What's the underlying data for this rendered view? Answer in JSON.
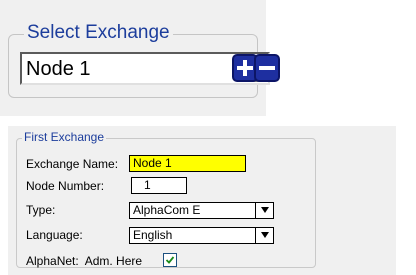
{
  "select_exchange": {
    "legend": "Select Exchange",
    "selected": "Node 1",
    "add_icon": "plus-icon",
    "remove_icon": "minus-icon"
  },
  "first_exchange": {
    "legend": "First Exchange",
    "exchange_name_label": "Exchange Name:",
    "exchange_name_value": "Node 1",
    "node_number_label": "Node Number:",
    "node_number_value": "1",
    "type_label": "Type:",
    "type_value": "AlphaCom E",
    "language_label": "Language:",
    "language_value": "English",
    "alphanet_label": "AlphaNet:  Adm. Here",
    "alphanet_checked": true
  },
  "colors": {
    "legend": "#1c3d9c",
    "highlight": "#ffff00",
    "button_blue": "#1e2fa0",
    "panel_bg": "#f0f0f0"
  }
}
